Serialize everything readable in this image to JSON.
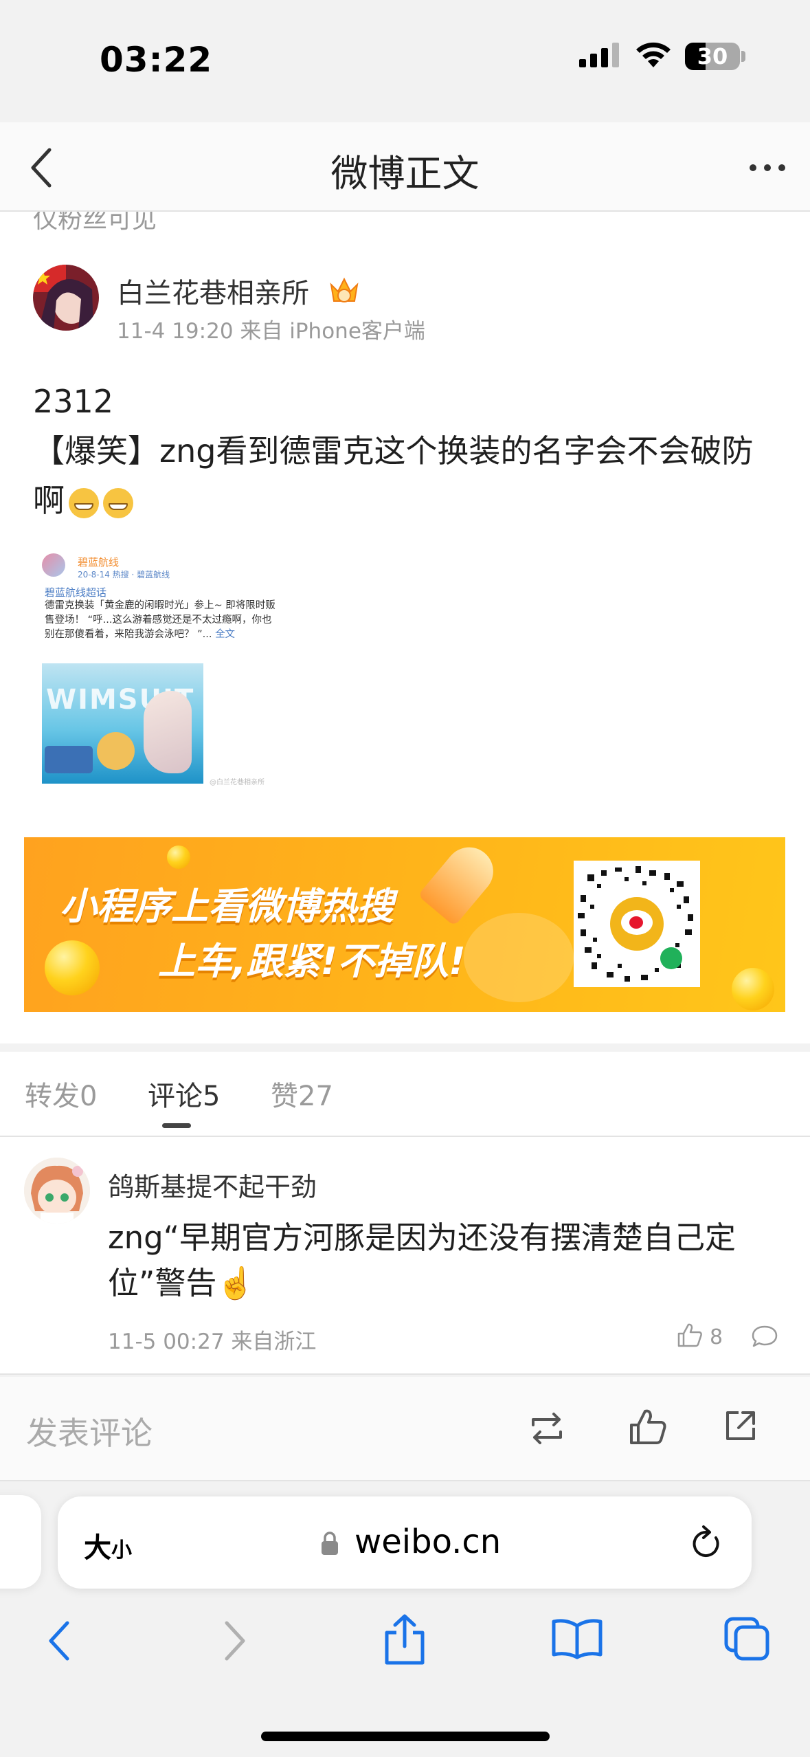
{
  "status_bar": {
    "time": "03:22",
    "battery": "30",
    "icons": [
      "signal-icon",
      "wifi-icon",
      "battery-icon"
    ]
  },
  "header": {
    "title": "微博正文",
    "back_icon": "chevron-left-icon",
    "more_icon": "more-icon"
  },
  "post": {
    "clipped_text": "仅粉丝可见",
    "author": "白兰花巷相亲所",
    "meta": "11-4 19:20 来自 iPhone客户端",
    "text_line1": "2312",
    "text_line2": "【爆笑】zng看到德雷克这个换装的名字会不会破防啊",
    "repost": {
      "name": "碧蓝航线",
      "time": "20-8-14 热搜 · 碧蓝航线",
      "topic": "碧蓝航线超话",
      "body": "德雷克换装「黄金鹿的闲暇时光」参上~ 即将限时贩售登场！ “呼...这么游着感觉还是不太过瘾啊，你也别在那傻看着，来陪我游会泳吧？ ”...",
      "more_link": "全文",
      "thumb_title": "WIMSUIT",
      "watermark": "@白兰花巷相亲所"
    }
  },
  "ad": {
    "line1": "小程序上看微博热搜",
    "line2": "上车,跟紧!不掉队!",
    "accent": "#ffb21a"
  },
  "tabs": {
    "reposts": "转发0",
    "comments": "评论5",
    "likes": "赞27"
  },
  "comment": {
    "author": "鸽斯基提不起干劲",
    "text": "zng“早期官方河豚是因为还没有摆清楚自己定位”警告☝️",
    "meta": "11-5 00:27 来自浙江",
    "like_count": "8"
  },
  "compose": {
    "placeholder": "发表评论"
  },
  "browser": {
    "reader_big": "大",
    "reader_small": "小",
    "url": "weibo.cn"
  },
  "colors": {
    "ios_blue": "#1a73e8",
    "weibo_orange": "#f28a2a",
    "text_gray": "#9a9a9a"
  }
}
